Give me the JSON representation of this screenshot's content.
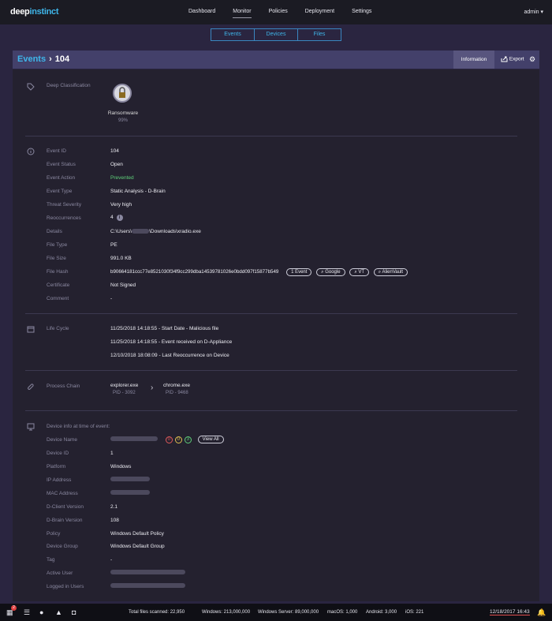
{
  "app": {
    "logo_prefix": "deep",
    "logo_suffix": "instinct"
  },
  "nav": {
    "items": [
      "Dashboard",
      "Monitor",
      "Policies",
      "Deployment",
      "Settings"
    ],
    "active": "Monitor",
    "user": "admin ▾"
  },
  "subnav": {
    "tabs": [
      "Events",
      "Devices",
      "Files"
    ]
  },
  "breadcrumb": {
    "parent": "Events",
    "separator": "›",
    "current": "104"
  },
  "toolbar": {
    "information_label": "Information",
    "export_label": "Export"
  },
  "classification": {
    "title": "Deep Classification",
    "name": "Ransomware",
    "percent": "99%"
  },
  "event": {
    "labels": {
      "event_id": "Event ID",
      "status": "Event Status",
      "action": "Event Action",
      "type": "Event Type",
      "severity": "Threat Severity",
      "reoccurrences": "Reoccurrences",
      "details": "Details",
      "file_type": "File Type",
      "file_size": "File Size",
      "file_hash": "File Hash",
      "certificate": "Certificate",
      "comment": "Comment"
    },
    "values": {
      "event_id": "104",
      "status": "Open",
      "action": "Prevented",
      "type": "Static Analysis - D-Brain",
      "severity": "Very high",
      "reoccurrences": "4",
      "details_prefix": "C:\\Users\\",
      "details_suffix": "\\Downloads\\xradio.exe",
      "file_type": "PE",
      "file_size": "991.0 KB",
      "file_hash": "b90664181ccc77e8521030f34f9cc299dba14539781026e0bdd097f15877b549",
      "certificate": "Not Signed",
      "comment": "-"
    },
    "hash_links": [
      "1 Event",
      "Google",
      "VT",
      "AlienVault"
    ]
  },
  "lifecycle": {
    "title": "Life Cycle",
    "entries": [
      "11/25/2018 14:18:55 - Start Date - Malicious file",
      "11/25/2018 14:18:55 - Event received on D-Appliance",
      "12/10/2018 18:08:09 - Last Reoccurrence on Device"
    ]
  },
  "process_chain": {
    "title": "Process Chain",
    "parent": {
      "name": "explorer.exe",
      "pid": "PID - 3092"
    },
    "child": {
      "name": "chrome.exe",
      "pid": "PID - 9468"
    }
  },
  "device": {
    "title": "Device info at time of event:",
    "labels": {
      "name": "Device Name",
      "id": "Device ID",
      "platform": "Platform",
      "ip": "IP Address",
      "mac": "MAC Address",
      "client_version": "D-Client Version",
      "brain_version": "D-Brain Version",
      "policy": "Policy",
      "group": "Device Group",
      "tag": "Tag",
      "active_user": "Active User",
      "logged_users": "Logged in Users"
    },
    "values": {
      "id": "1",
      "platform": "Windows",
      "client_version": "2.1",
      "brain_version": "108",
      "policy": "Windows Default Policy",
      "group": "Windows Default Group",
      "tag": "-"
    },
    "counters": [
      {
        "value": "0",
        "color": "#e05a5a"
      },
      {
        "value": "0",
        "color": "#e0c050"
      },
      {
        "value": "3",
        "color": "#5fd07a"
      }
    ],
    "view_all": "View All"
  },
  "taskbar": {
    "notification_count": "2",
    "total_files": "Total files scanned: 22,950",
    "windows": "Windows: 213,000,000",
    "windows_server": "Windows Server: 89,000,000",
    "macos": "macOS: 1,000",
    "android": "Android: 3,000",
    "ios": "iOS: 221",
    "datetime": "12/18/2017 16:43"
  }
}
